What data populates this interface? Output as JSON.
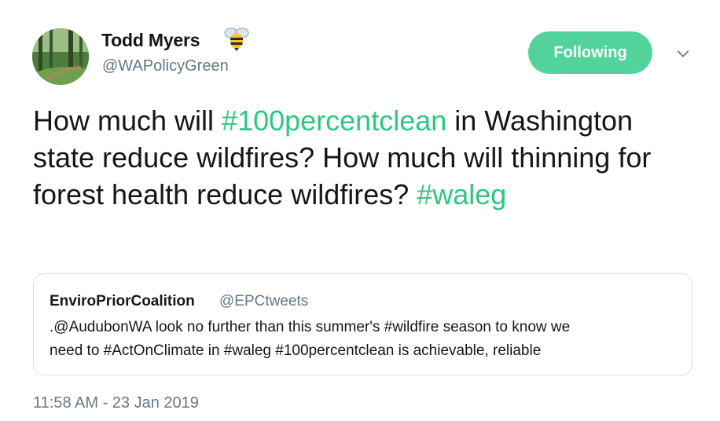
{
  "author": {
    "name": "Todd Myers",
    "handle": "@WAPolicyGreen",
    "badge_icon": "bee-icon",
    "avatar_icon": "forest-avatar"
  },
  "follow_button": {
    "label": "Following"
  },
  "menu": {
    "icon": "chevron-down-icon"
  },
  "tweet": {
    "segments": [
      {
        "text": "How much will ",
        "type": "text"
      },
      {
        "text": "#100percentclean",
        "type": "hashtag"
      },
      {
        "text": " in Washington state reduce wildfires? How much will thinning for forest health reduce wildfires?  ",
        "type": "text"
      },
      {
        "text": "#waleg",
        "type": "hashtag"
      }
    ]
  },
  "quote": {
    "author": "EnviroPriorCoalition",
    "handle": "@EPCtweets",
    "line1": ".@AudubonWA look no further than this summer's #wildfire season to know we",
    "line2": "need to #ActOnClimate in #waleg #100percentclean is achievable, reliable"
  },
  "timestamp": "11:58 AM - 23 Jan 2019",
  "colors": {
    "accent": "#52d39c",
    "hashtag": "#2ec77f",
    "secondary_text": "#657786",
    "primary_text": "#14171a"
  }
}
